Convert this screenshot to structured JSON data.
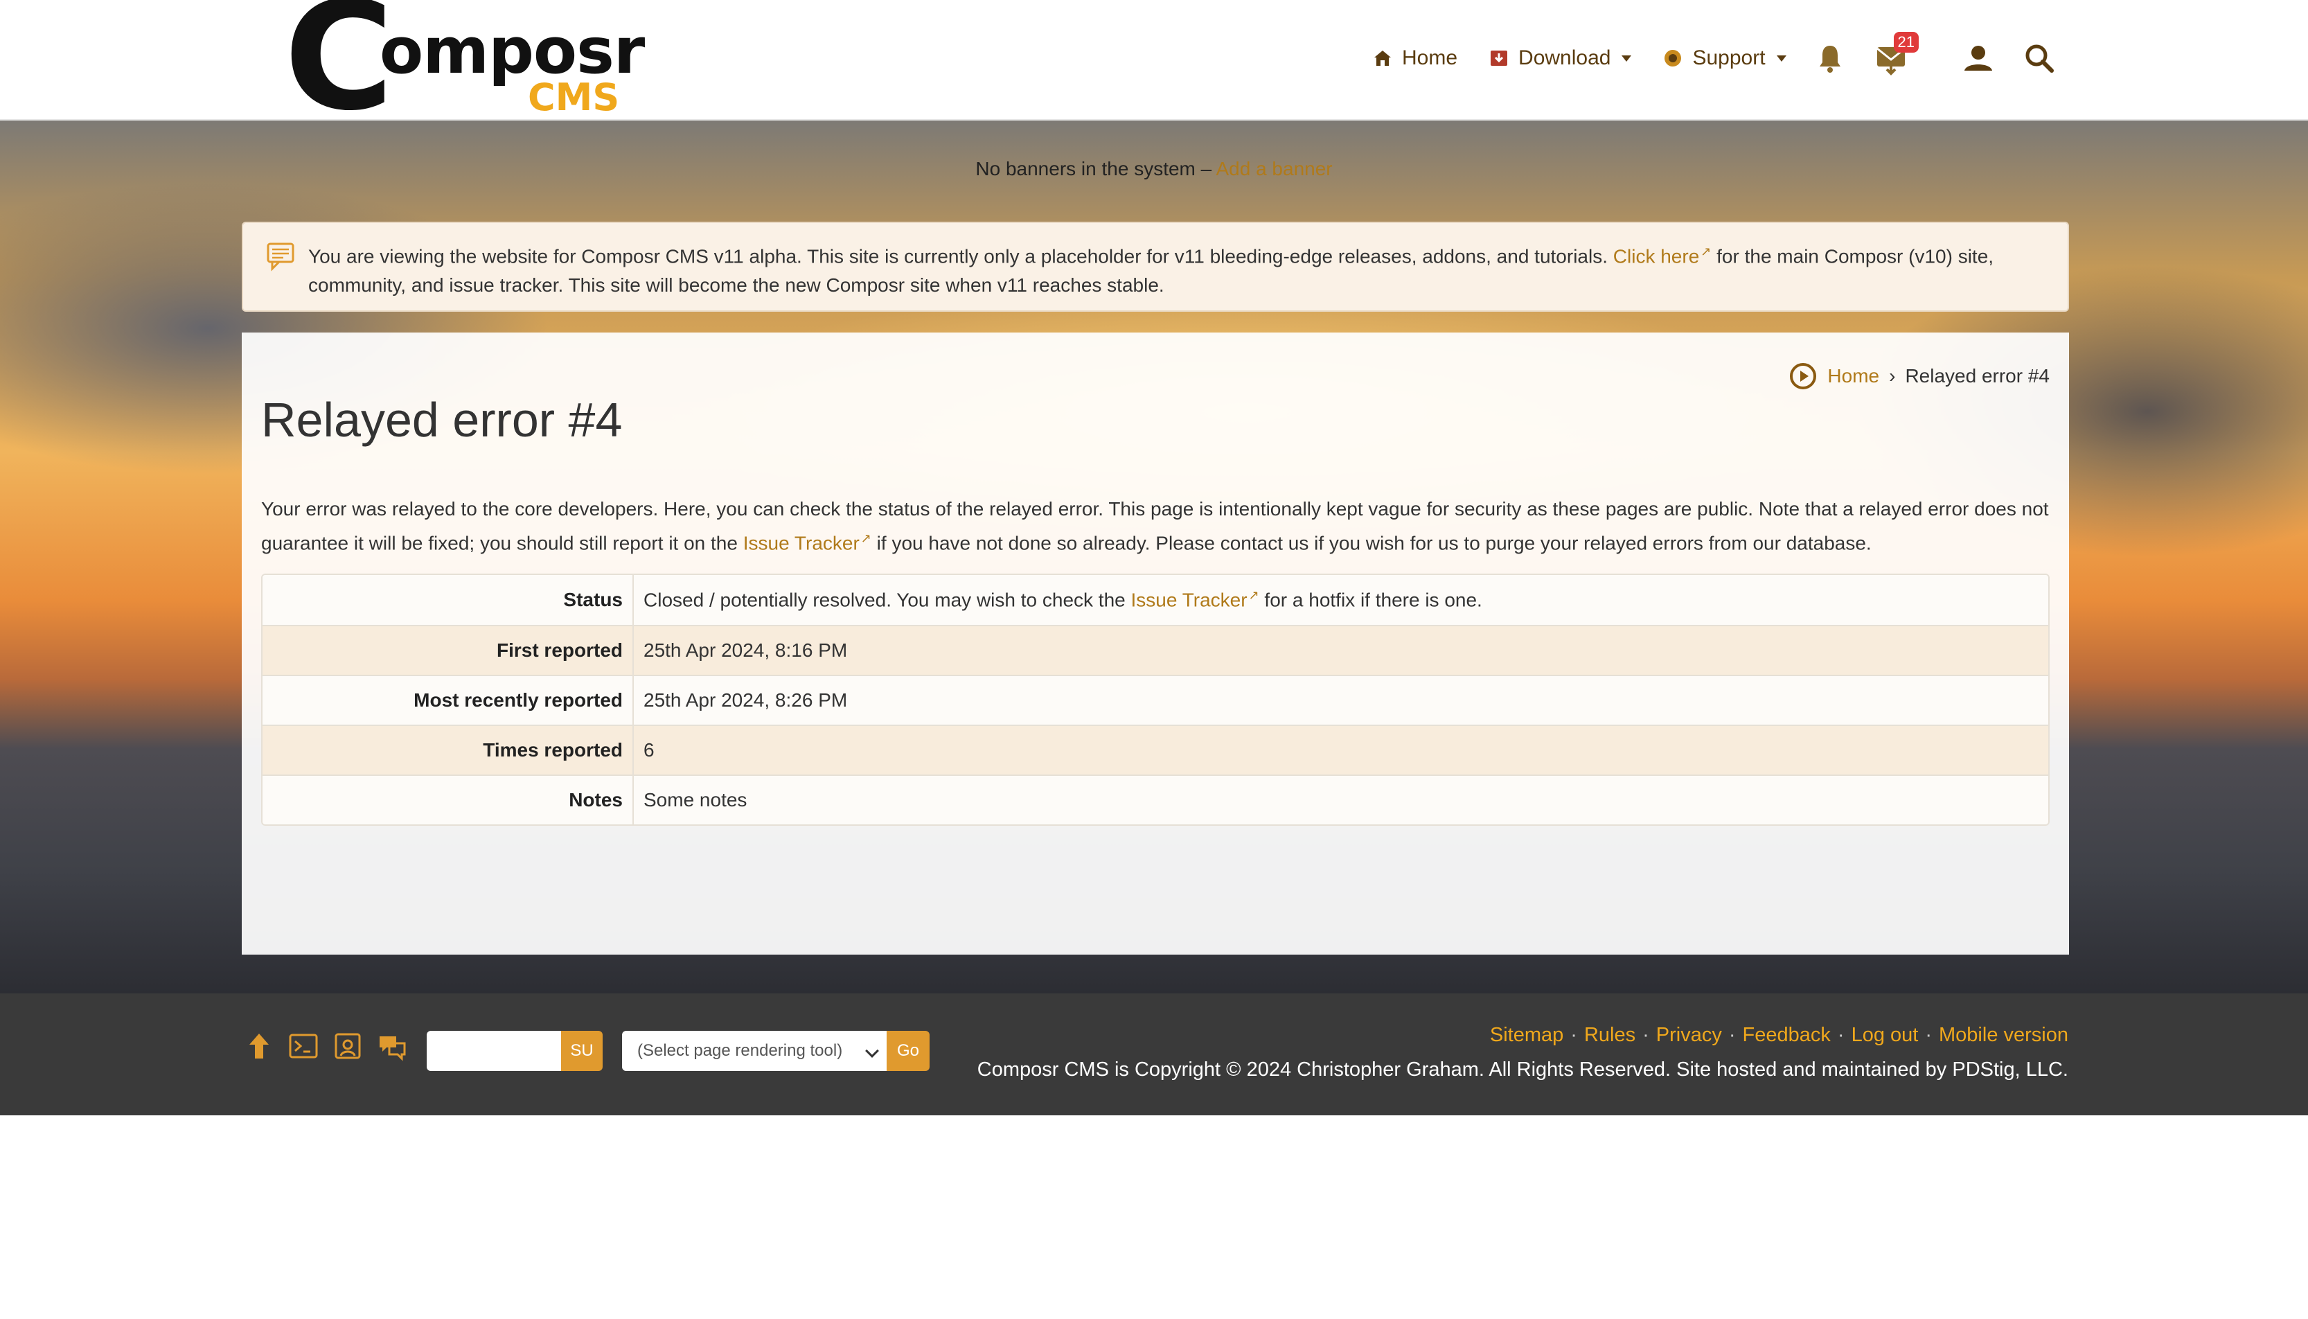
{
  "logo": {
    "main": "omposr",
    "letter": "C",
    "sub": "CMS"
  },
  "nav": {
    "home": "Home",
    "download": "Download",
    "support": "Support",
    "messages_badge": "21"
  },
  "banner": {
    "text": "No banners in the system – ",
    "link": "Add a banner"
  },
  "notice": {
    "text_before": "You are viewing the website for Composr CMS v11 alpha. This site is currently only a placeholder for v11 bleeding-edge releases, addons, and tutorials. ",
    "link": "Click here",
    "text_after": " for the main Composr (v10) site, community, and issue tracker. This site will become the new Composr site when v11 reaches stable."
  },
  "breadcrumb": {
    "home": "Home",
    "current": "Relayed error #4"
  },
  "page_title": "Relayed error #4",
  "intro": {
    "text_before": "Your error was relayed to the core developers. Here, you can check the status of the relayed error. This page is intentionally kept vague for security as these pages are public. Note that a relayed error does not guarantee it will be fixed; you should still report it on the ",
    "link": "Issue Tracker",
    "text_after": " if you have not done so already. Please contact us if you wish for us to purge your relayed errors from our database."
  },
  "details": {
    "status_label": "Status",
    "status_before": "Closed / potentially resolved. You may wish to check the ",
    "status_link": "Issue Tracker",
    "status_after": " for a hotfix if there is one.",
    "first_label": "First reported",
    "first_value": "25th Apr 2024, 8:16 PM",
    "recent_label": "Most recently reported",
    "recent_value": "25th Apr 2024, 8:26 PM",
    "times_label": "Times reported",
    "times_value": "6",
    "notes_label": "Notes",
    "notes_value": "Some notes"
  },
  "footer": {
    "su_button": "SU",
    "select_placeholder": "(Select page rendering tool)",
    "go_button": "Go",
    "links": [
      "Sitemap",
      "Rules",
      "Privacy",
      "Feedback",
      "Log out",
      "Mobile version"
    ],
    "copyright": "Composr CMS is Copyright © 2024 Christopher Graham. All Rights Reserved. Site hosted and maintained by PDStig, LLC."
  },
  "colors": {
    "accent": "#b07a1a",
    "footer_bg": "#3a3a3a",
    "button": "#e09a2e"
  }
}
